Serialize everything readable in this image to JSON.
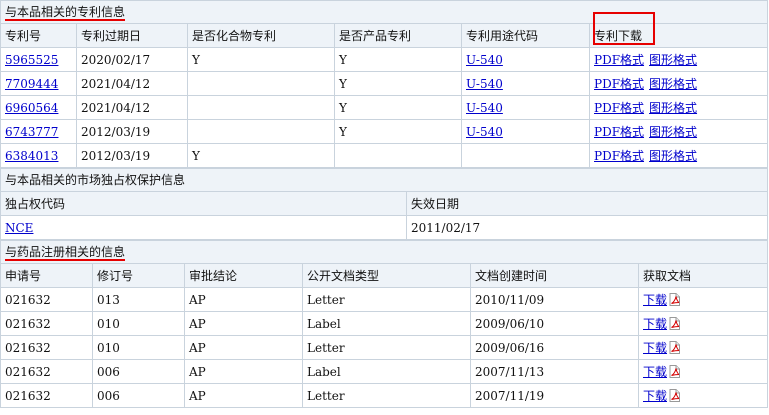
{
  "patent": {
    "section_title": "与本品相关的专利信息",
    "headers": [
      "专利号",
      "专利过期日",
      "是否化合物专利",
      "是否产品专利",
      "专利用途代码",
      "专利下载"
    ],
    "rows": [
      {
        "no": "5965525",
        "expiry": "2020/02/17",
        "compound": "Y",
        "product": "Y",
        "use_code": "U-540",
        "pdf": "PDF格式",
        "img": "图形格式"
      },
      {
        "no": "7709444",
        "expiry": "2021/04/12",
        "compound": "",
        "product": "Y",
        "use_code": "U-540",
        "pdf": "PDF格式",
        "img": "图形格式"
      },
      {
        "no": "6960564",
        "expiry": "2021/04/12",
        "compound": "",
        "product": "Y",
        "use_code": "U-540",
        "pdf": "PDF格式",
        "img": "图形格式"
      },
      {
        "no": "6743777",
        "expiry": "2012/03/19",
        "compound": "",
        "product": "Y",
        "use_code": "U-540",
        "pdf": "PDF格式",
        "img": "图形格式"
      },
      {
        "no": "6384013",
        "expiry": "2012/03/19",
        "compound": "Y",
        "product": "",
        "use_code": "",
        "pdf": "PDF格式",
        "img": "图形格式"
      }
    ]
  },
  "exclusivity": {
    "section_title": "与本品相关的市场独占权保护信息",
    "headers": [
      "独占权代码",
      "失效日期"
    ],
    "rows": [
      {
        "code": "NCE",
        "expiry": "2011/02/17"
      }
    ]
  },
  "registration": {
    "section_title": "与药品注册相关的信息",
    "headers": [
      "申请号",
      "修订号",
      "审批结论",
      "公开文档类型",
      "文档创建时间",
      "获取文档"
    ],
    "rows": [
      {
        "app": "021632",
        "rev": "013",
        "result": "AP",
        "type": "Letter",
        "date": "2010/11/09",
        "download": "下载"
      },
      {
        "app": "021632",
        "rev": "010",
        "result": "AP",
        "type": "Label",
        "date": "2009/06/10",
        "download": "下载"
      },
      {
        "app": "021632",
        "rev": "010",
        "result": "AP",
        "type": "Letter",
        "date": "2009/06/16",
        "download": "下载"
      },
      {
        "app": "021632",
        "rev": "006",
        "result": "AP",
        "type": "Label",
        "date": "2007/11/13",
        "download": "下载"
      },
      {
        "app": "021632",
        "rev": "006",
        "result": "AP",
        "type": "Letter",
        "date": "2007/11/19",
        "download": "下载"
      }
    ]
  },
  "colors": {
    "link": "#0000cc",
    "highlight": "#e60000",
    "section_bg": "#eef3f8",
    "border": "#c9d3dd"
  },
  "icons": {
    "pdf": "pdf-file-icon"
  }
}
